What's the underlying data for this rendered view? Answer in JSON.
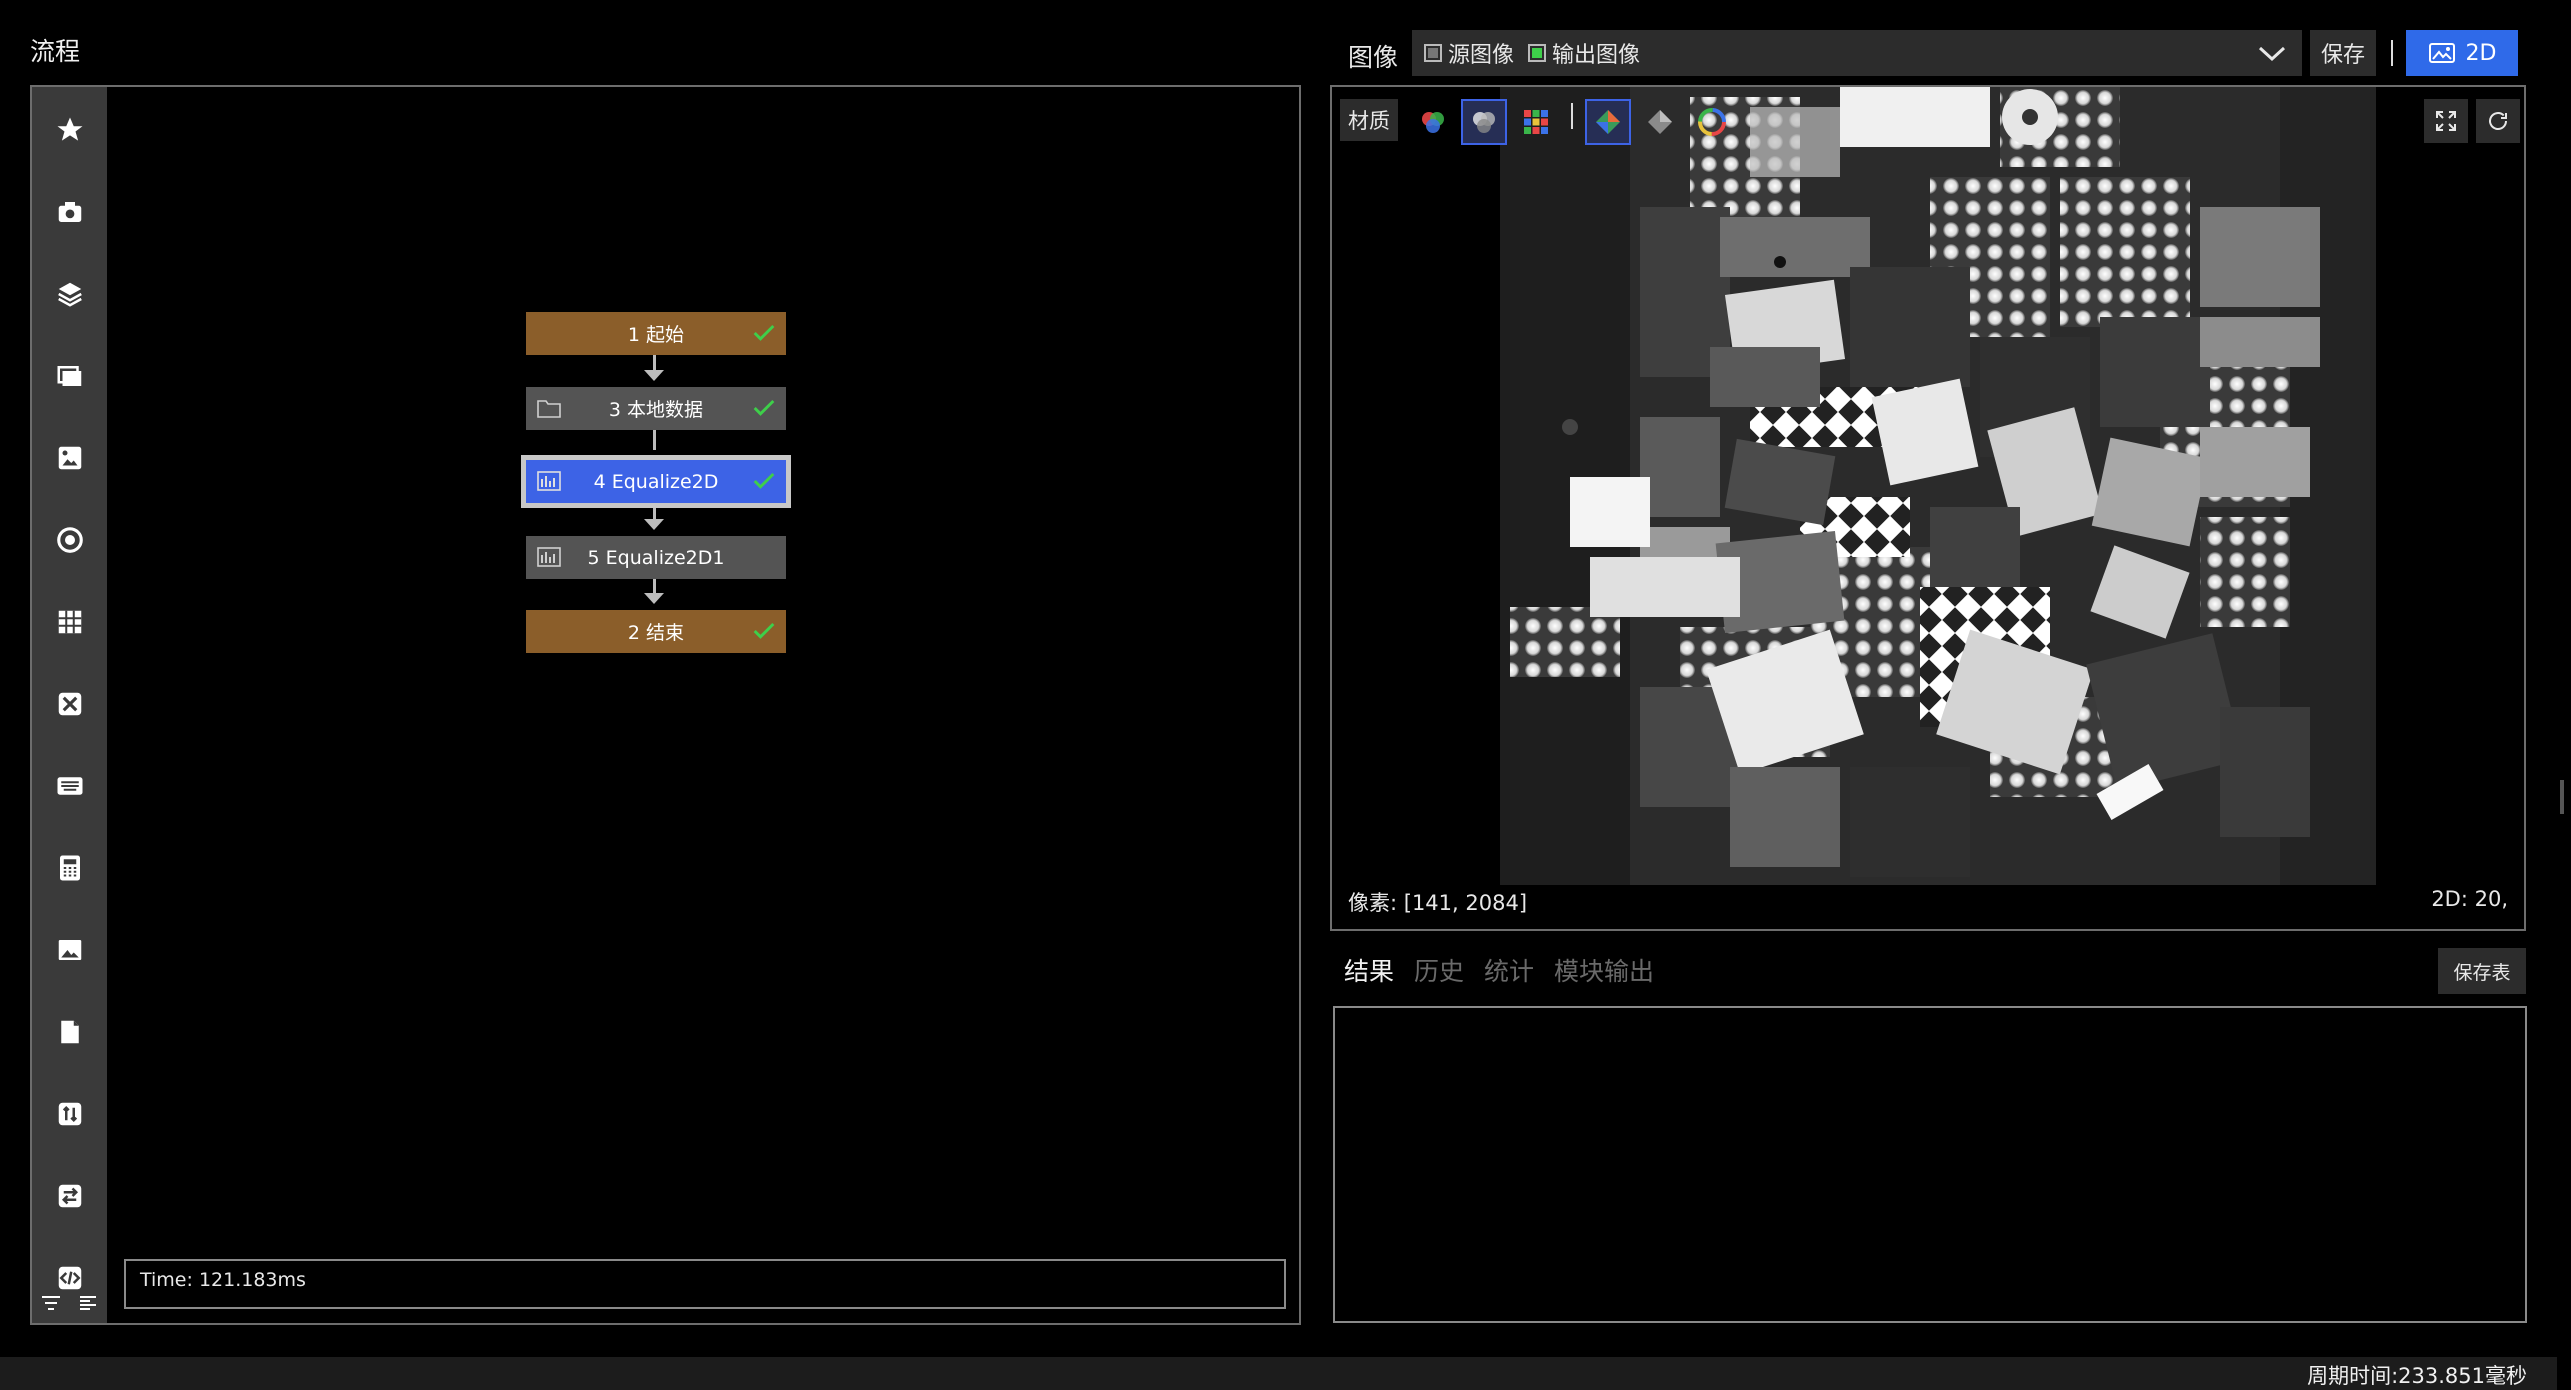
{
  "flow": {
    "title": "流程",
    "nodes": [
      {
        "label": "1 起始",
        "status": "success"
      },
      {
        "label": "3 本地数据",
        "status": "success",
        "icon": "folder-icon"
      },
      {
        "label": "4 Equalize2D",
        "status": "success",
        "icon": "histogram-icon",
        "selected": true
      },
      {
        "label": "5 Equalize2D1",
        "status": "idle",
        "icon": "histogram-icon"
      },
      {
        "label": "2 结束",
        "status": "success"
      }
    ],
    "time_text": "Time: 121.183ms",
    "toolbar_icons": [
      "star-icon",
      "camera-icon",
      "layers-icon",
      "slides-icon",
      "image-edit-icon",
      "target-icon",
      "grid-icon",
      "tools-icon",
      "keyboard-icon",
      "calculator-icon",
      "picture-icon",
      "document-icon",
      "transfer-icon",
      "swap-icon",
      "code-icon"
    ],
    "bottom_icons": [
      "filter-icon",
      "list-icon"
    ]
  },
  "image_panel": {
    "title": "图像",
    "source_image_label": "源图像",
    "output_image_label": "输出图像",
    "source_checked": false,
    "output_checked": true,
    "save_label": "保存",
    "mode_label": "2D",
    "material_label": "材质",
    "pixel_readout": "像素: [141, 2084]",
    "mode_readout": "2D: 20,"
  },
  "results": {
    "tabs": [
      "结果",
      "历史",
      "统计",
      "模块输出"
    ],
    "active_tab": 0,
    "save_table_label": "保存表"
  },
  "status_bar": {
    "cycle_time": "周期时间:233.851毫秒"
  },
  "colors": {
    "terminal_node": "#8b5e2a",
    "process_node": "#545454",
    "active_node": "#3d63e6",
    "check": "#3ecf4a",
    "accent": "#2f6ae9"
  }
}
